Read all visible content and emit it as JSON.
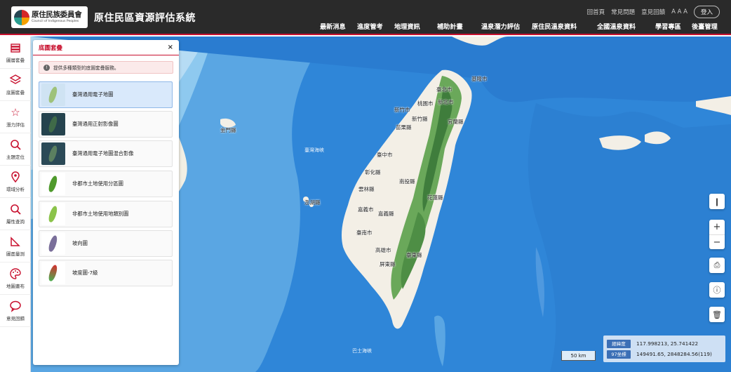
{
  "header": {
    "logo_zh": "原住民族委員會",
    "logo_en": "Council of Indigenous Peoples",
    "app_title": "原住民區資源評估系統",
    "util_links": [
      "回首頁",
      "常見問題",
      "意見回饋",
      "A A A"
    ],
    "login_label": "登入",
    "nav": [
      "最新消息",
      "進度管考",
      "地理資訊",
      "補助計畫",
      "溫泉潛力評估",
      "原住民溫泉資料",
      "全國溫泉資料",
      "學習專區",
      "後臺管理"
    ]
  },
  "left_tools": [
    {
      "icon": "layers-icon",
      "label": "圖層套疊"
    },
    {
      "icon": "stack-icon",
      "label": "底圖套疊"
    },
    {
      "icon": "star-icon",
      "label": "潛力評估"
    },
    {
      "icon": "locate-icon",
      "label": "主題定位"
    },
    {
      "icon": "pin-icon",
      "label": "環域分析"
    },
    {
      "icon": "magnify-icon",
      "label": "屬性查詢"
    },
    {
      "icon": "ruler-icon",
      "label": "圖面量測"
    },
    {
      "icon": "palette-icon",
      "label": "地圖畫布"
    },
    {
      "icon": "chat-icon",
      "label": "意見回饋"
    }
  ],
  "panel": {
    "title": "底圖套疊",
    "close": "×",
    "notice": "提供多種類型的底圖套疊服務。",
    "layers": [
      {
        "label": "臺灣通用電子地圖",
        "active": true
      },
      {
        "label": "臺灣通用正射影像圖",
        "active": false
      },
      {
        "label": "臺灣通用電子地圖混合影像",
        "active": false
      },
      {
        "label": "非都市土地使用分區圖",
        "active": false
      },
      {
        "label": "非都市土地使用地類別圖",
        "active": false
      },
      {
        "label": "坡向圖",
        "active": false
      },
      {
        "label": "坡度圖-7級",
        "active": false
      }
    ]
  },
  "map": {
    "scale": "50 km",
    "coord_labels": [
      "經緯度",
      "97坐標"
    ],
    "coord_values": [
      "117.998213, 25.741422",
      "149491.65, 2848284.56(119)"
    ],
    "place_labels": [
      "基隆市",
      "臺北市",
      "桃園市",
      "新北市",
      "新竹市",
      "新竹縣",
      "苗栗縣",
      "宜蘭縣",
      "臺中市",
      "彰化縣",
      "南投縣",
      "雲林縣",
      "花蓮縣",
      "嘉義市",
      "嘉義縣",
      "臺南市",
      "高雄市",
      "臺東縣",
      "屏東縣",
      "金門縣",
      "澎湖縣",
      "臺灣海峽",
      "巴士海峽"
    ],
    "colors": {
      "sea": "#2f86d8",
      "shallow": "#8ec9ef",
      "land": "#f3efe6",
      "mountain": "#5e9a4e",
      "accent": "#c8102e"
    }
  }
}
